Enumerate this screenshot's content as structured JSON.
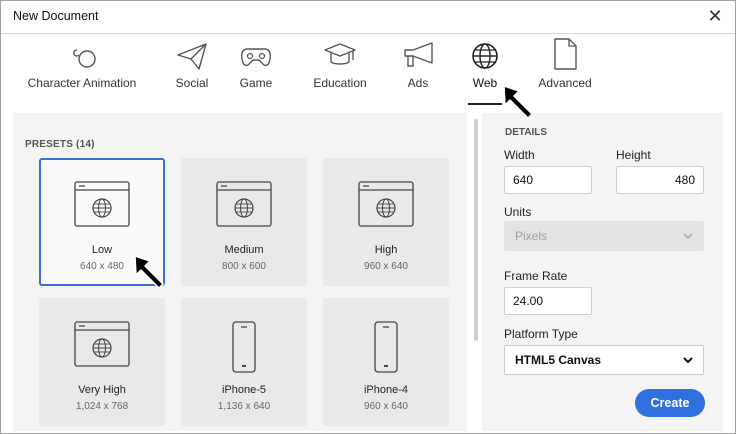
{
  "window": {
    "title": "New Document",
    "close_glyph": "✕"
  },
  "tabs": [
    {
      "label": "Character Animation",
      "icon": "character-animation-icon"
    },
    {
      "label": "Social",
      "icon": "social-paper-plane-icon"
    },
    {
      "label": "Game",
      "icon": "game-controller-icon"
    },
    {
      "label": "Education",
      "icon": "education-cap-icon"
    },
    {
      "label": "Ads",
      "icon": "ads-megaphone-icon"
    },
    {
      "label": "Web",
      "icon": "web-globe-icon",
      "active": true
    },
    {
      "label": "Advanced",
      "icon": "advanced-document-icon"
    }
  ],
  "presets": {
    "label": "PRESETS (14)",
    "items": [
      {
        "name": "Low",
        "dims": "640 x 480",
        "icon": "browser-window-icon",
        "selected": true
      },
      {
        "name": "Medium",
        "dims": "800 x 600",
        "icon": "browser-window-icon"
      },
      {
        "name": "High",
        "dims": "960 x 640",
        "icon": "browser-window-icon"
      },
      {
        "name": "Very High",
        "dims": "1,024 x 768",
        "icon": "browser-window-icon"
      },
      {
        "name": "iPhone-5",
        "dims": "1,136 x 640",
        "icon": "phone-icon"
      },
      {
        "name": "iPhone-4",
        "dims": "960 x 640",
        "icon": "phone-icon"
      }
    ]
  },
  "details": {
    "label": "DETAILS",
    "width_label": "Width",
    "width_value": "640",
    "height_label": "Height",
    "height_value": "480",
    "units_label": "Units",
    "units_value": "Pixels",
    "frame_rate_label": "Frame Rate",
    "frame_rate_value": "24.00",
    "platform_label": "Platform Type",
    "platform_value": "HTML5 Canvas",
    "create_label": "Create"
  },
  "colors": {
    "accent": "#2f6fe0",
    "selected_border": "#3b6fd6",
    "panel": "#f4f4f4"
  }
}
